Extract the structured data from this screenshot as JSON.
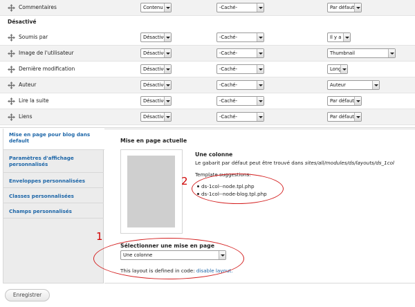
{
  "rows": [
    {
      "label": "Commentaires",
      "format": "Contenu",
      "label_setting": "-Caché-",
      "display": "Par défaut"
    },
    {
      "label": "Soumis par",
      "format": "Désactivé",
      "label_setting": "-Caché-",
      "display": "Il y a"
    },
    {
      "label": "Image de l'utilisateur",
      "format": "Désactivé",
      "label_setting": "-Caché-",
      "display": "Thumbnail"
    },
    {
      "label": "Dernière modification",
      "format": "Désactivé",
      "label_setting": "-Caché-",
      "display": "Long"
    },
    {
      "label": "Auteur",
      "format": "Désactivé",
      "label_setting": "-Caché-",
      "display": "Auteur"
    },
    {
      "label": "Lire la suite",
      "format": "Désactivé",
      "label_setting": "-Caché-",
      "display": "Par défaut"
    },
    {
      "label": "Liens",
      "format": "Désactivé",
      "label_setting": "-Caché-",
      "display": "Par défaut"
    }
  ],
  "region_header": "Désactivé",
  "vertical_tabs": [
    "Mise en page pour blog dans default",
    "Paramètres d'affichage personnalisés",
    "Enveloppes personnalisées",
    "Classes personnalisées",
    "Champs personnalisés"
  ],
  "panel": {
    "title": "Mise en page actuelle",
    "layout_name": "Une colonne",
    "layout_desc_prefix": "Le gabarit par défaut peut être trouvé dans ",
    "layout_desc_path": "sites/all/modules/ds/layouts/ds_1col",
    "suggestions_title": "Template suggestions:",
    "suggestions": [
      "ds-1col--node.tpl.php",
      "ds-1col--node-blog.tpl.php"
    ],
    "select_label": "Sélectionner une mise en page",
    "select_value": "Une colonne",
    "defined_text": "This layout is defined in code: ",
    "defined_link": "disable layout."
  },
  "annotations": {
    "one": "1",
    "two": "2"
  },
  "save_button": "Enregistrer",
  "colors": {
    "link": "#1d66a8",
    "annotation": "#d42020",
    "row_alt": "#f2f2f2"
  }
}
